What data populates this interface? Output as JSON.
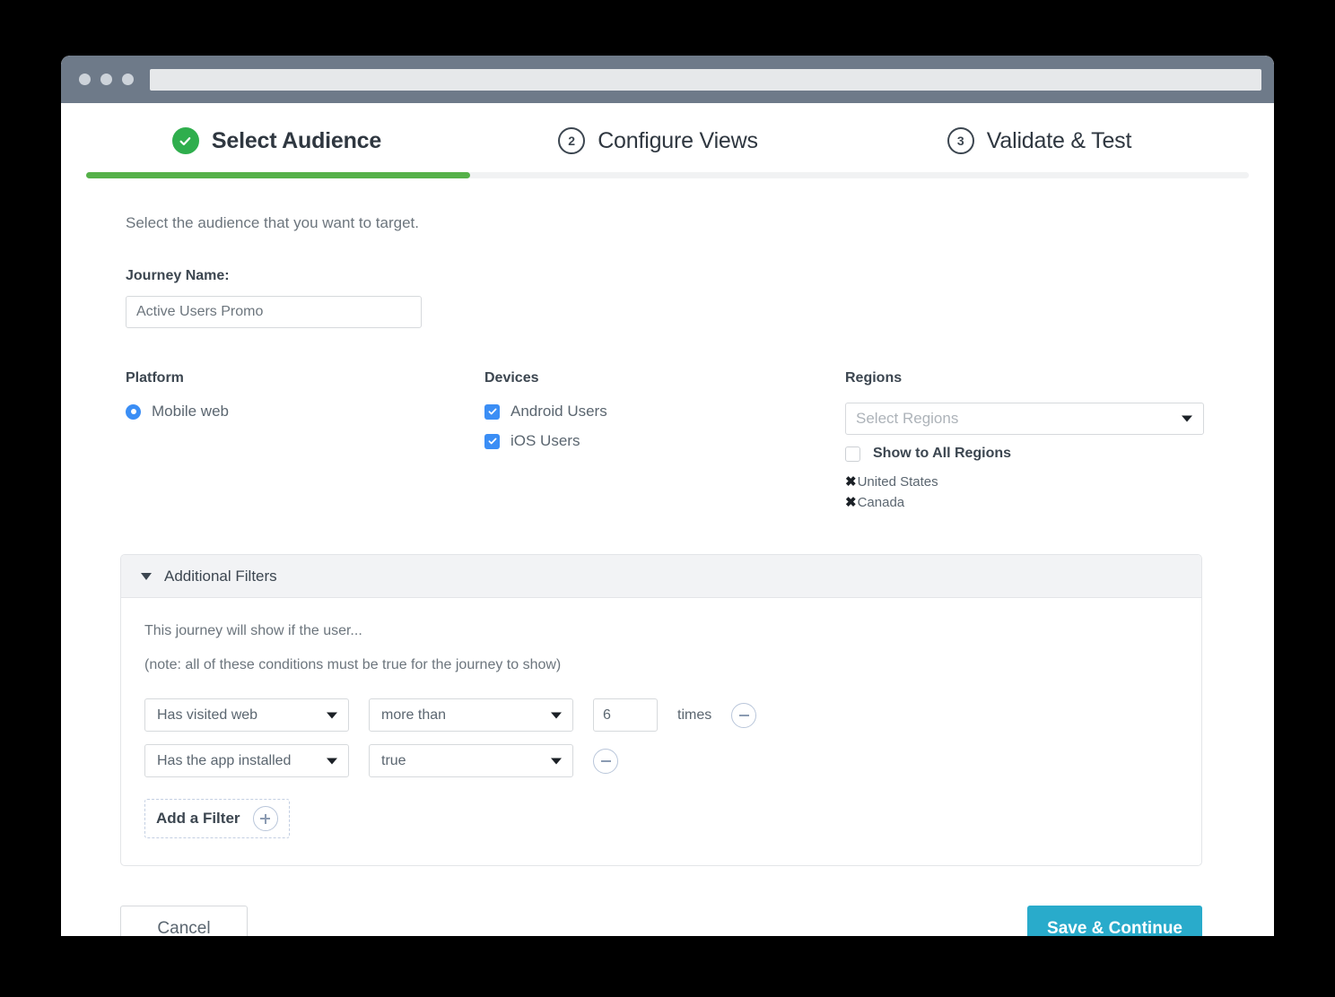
{
  "browser": {
    "address_value": "",
    "dots": [
      "dot-1",
      "dot-2",
      "dot-3"
    ]
  },
  "wizard": {
    "steps": [
      {
        "badge": "check",
        "label": "Select Audience",
        "state": "completed"
      },
      {
        "badge": "2",
        "label": "Configure Views",
        "state": "upcoming"
      },
      {
        "badge": "3",
        "label": "Validate & Test",
        "state": "upcoming"
      }
    ],
    "progress_percent": 33,
    "progress_color": "#55b149"
  },
  "main": {
    "intro": "Select the audience that you want to target.",
    "journey": {
      "label": "Journey Name:",
      "value": "Active Users Promo",
      "placeholder": "Journey Name"
    },
    "platform": {
      "title": "Platform",
      "options": [
        {
          "label": "Mobile web",
          "selected": true
        }
      ]
    },
    "devices": {
      "title": "Devices",
      "options": [
        {
          "label": "Android Users",
          "checked": true
        },
        {
          "label": "iOS Users",
          "checked": true
        }
      ]
    },
    "regions": {
      "title": "Regions",
      "select_placeholder": "Select Regions",
      "select_value": "",
      "show_all_label": "Show to All Regions",
      "show_all_checked": false,
      "chips": [
        {
          "remove": "✖",
          "label": "United States"
        },
        {
          "remove": "✖",
          "label": "Canada"
        }
      ]
    },
    "filters": {
      "header": "Additional Filters",
      "expanded": true,
      "note_1": "This journey will show if the user...",
      "note_2": "(note: all of these conditions must be true for the journey to show)",
      "rows": [
        {
          "attribute": "Has visited web",
          "operator": "more than",
          "value": "6",
          "unit": "times",
          "has_value_field": true
        },
        {
          "attribute": "Has the app installed",
          "operator": "true",
          "value": "",
          "unit": "",
          "has_value_field": false
        }
      ],
      "add_label": "Add a Filter"
    }
  },
  "footer": {
    "cancel_label": "Cancel",
    "save_label": "Save & Continue",
    "save_color": "#29abcb"
  }
}
